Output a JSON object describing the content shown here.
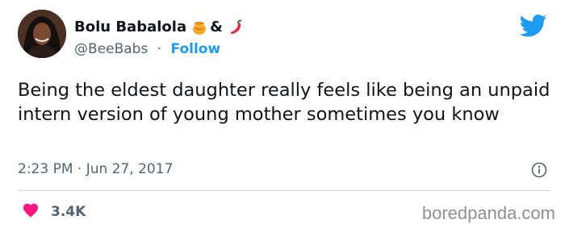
{
  "author": {
    "display_name": "Bolu Babalola",
    "emoji_1": "honey-pot-emoji",
    "ampersand": "&",
    "emoji_2": "hot-pepper-emoji",
    "handle": "@BeeBabs",
    "separator": "·",
    "follow_label": "Follow"
  },
  "tweet": {
    "text": "Being the eldest daughter really feels like being an unpaid intern version of young mother sometimes you know",
    "time": "2:23 PM · Jun 27, 2017"
  },
  "engagement": {
    "likes": "3.4K"
  },
  "watermark": "boredpanda.com",
  "colors": {
    "accent": "#1d9bf0",
    "like": "#f91880",
    "secondary_text": "#536471"
  },
  "icons": [
    "twitter-bird-icon",
    "info-icon",
    "heart-icon"
  ]
}
